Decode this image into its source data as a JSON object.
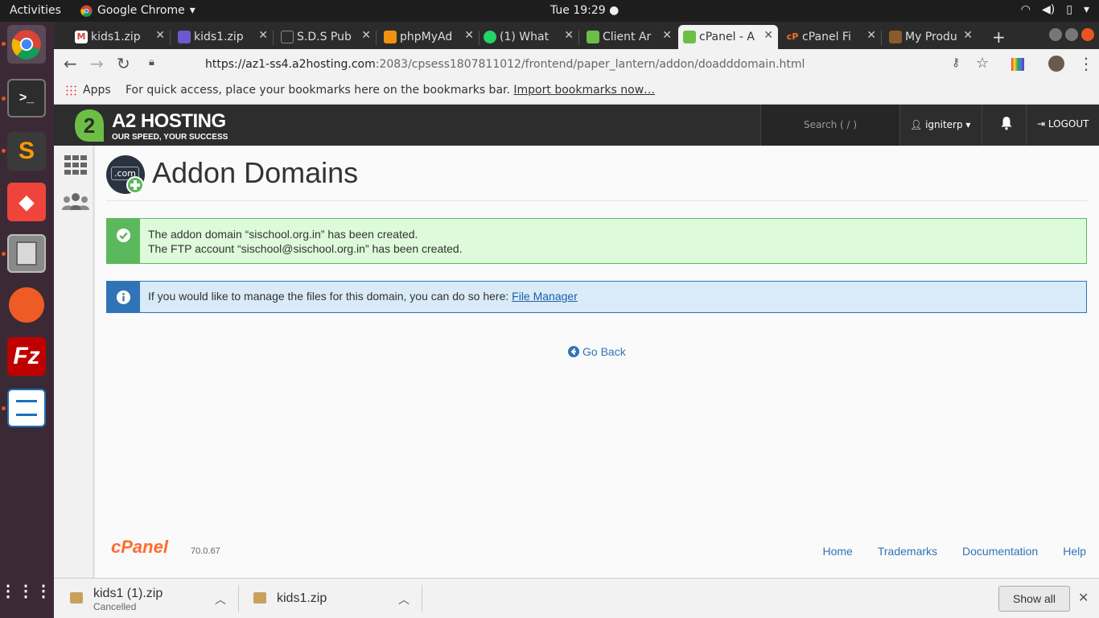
{
  "os": {
    "activities": "Activities",
    "app_menu": "Google Chrome",
    "clock": "Tue 19:29"
  },
  "dock": {
    "items": [
      "chrome-icon",
      "terminal-icon",
      "sublime-text-icon",
      "anydesk-icon",
      "file-cabinet-icon",
      "postman-icon",
      "filezilla-icon",
      "libreoffice-writer-icon",
      "show-apps-icon"
    ]
  },
  "browser": {
    "tabs": [
      {
        "label": "kids1.zip",
        "icon": "gmail-icon"
      },
      {
        "label": "kids1.zip",
        "icon": "document-icon"
      },
      {
        "label": "S.D.S Pub",
        "icon": "page-icon"
      },
      {
        "label": "phpMyAd",
        "icon": "phpmyadmin-icon"
      },
      {
        "label": "(1) What",
        "icon": "whatsapp-icon"
      },
      {
        "label": "Client Ar",
        "icon": "a2-icon"
      },
      {
        "label": "cPanel - A",
        "icon": "a2-icon"
      },
      {
        "label": "cPanel Fi",
        "icon": "cpanel-icon"
      },
      {
        "label": "My Produ",
        "icon": "product-icon"
      }
    ],
    "active_tab": 6,
    "url_host": "https://az1-ss4.a2hosting.com",
    "url_path": ":2083/cpsess1807811012/frontend/paper_lantern/addon/doadddomain.html",
    "bookmarks": {
      "apps": "Apps",
      "hint": "For quick access, place your bookmarks here on the bookmarks bar.",
      "import_link": "Import bookmarks now…"
    }
  },
  "cpanel_header": {
    "brand": "A2 HOSTING",
    "tagline": "OUR SPEED, YOUR SUCCESS",
    "search_placeholder": "Search ( / )",
    "username": "igniterp",
    "logout": "LOGOUT"
  },
  "page": {
    "title": "Addon Domains",
    "icon_text": ".com",
    "success_line1": "The addon domain “sischool.org.in” has been created.",
    "success_line2": "The FTP account “sischool@sischool.org.in” has been created.",
    "info_text": "If you would like to manage the files for this domain, you can do so here:",
    "info_link": "File Manager",
    "go_back": "Go Back"
  },
  "footer": {
    "logo": "cPanel",
    "version": "70.0.67",
    "links": [
      "Home",
      "Trademarks",
      "Documentation",
      "Help"
    ]
  },
  "downloads": {
    "items": [
      {
        "name": "kids1 (1).zip",
        "status": "Cancelled"
      },
      {
        "name": "kids1.zip",
        "status": ""
      }
    ],
    "show_all": "Show all"
  },
  "colors": {
    "success": "#5cb85c",
    "info": "#2f74b7",
    "brand_green": "#6dbe45",
    "cpanel_orange": "#ff6c2c"
  }
}
